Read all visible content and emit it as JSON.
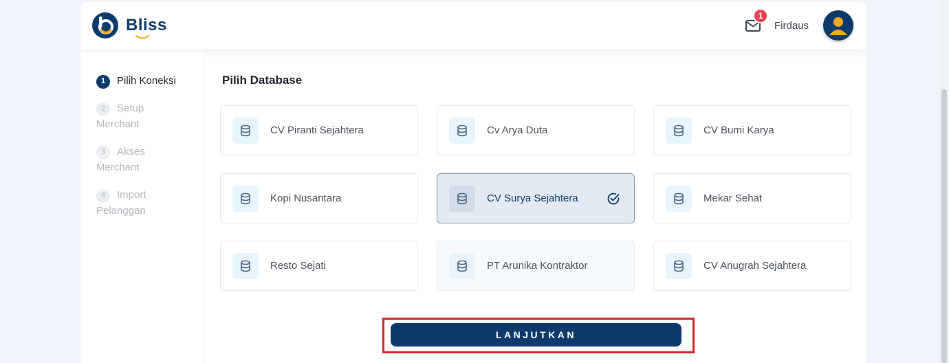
{
  "header": {
    "logo_text": "Bliss",
    "mail_badge_count": "1",
    "username": "Firdaus"
  },
  "sidebar": {
    "steps": [
      {
        "number": "1",
        "label": "Pilih Koneksi",
        "state": "active"
      },
      {
        "number": "2",
        "label": "Setup Merchant",
        "state": "inactive"
      },
      {
        "number": "3",
        "label": "Akses Merchant",
        "state": "inactive"
      },
      {
        "number": "4",
        "label": "Import Pelanggan",
        "state": "inactive"
      }
    ]
  },
  "main": {
    "title": "Pilih Database",
    "databases": [
      {
        "name": "CV Piranti Sejahtera",
        "selected": false
      },
      {
        "name": "Cv Arya Duta",
        "selected": false
      },
      {
        "name": "CV Bumi Karya",
        "selected": false
      },
      {
        "name": "Kopi Nusantara",
        "selected": false
      },
      {
        "name": "CV Surya Sejahtera",
        "selected": true
      },
      {
        "name": "Mekar Sehat",
        "selected": false
      },
      {
        "name": "Resto Sejati",
        "selected": false
      },
      {
        "name": "PT Arunika Kontraktor",
        "selected": false
      },
      {
        "name": "CV Anugrah Sejahtera",
        "selected": false
      }
    ],
    "continue_label": "LANJUTKAN"
  },
  "colors": {
    "primary": "#0c3a6b",
    "accent": "#f5a623",
    "badge": "#e8424f",
    "highlight_outline": "#d7272d"
  },
  "icons": [
    "bliss-logo",
    "mail-icon",
    "user-avatar-icon",
    "database-icon",
    "check-circle-icon"
  ]
}
